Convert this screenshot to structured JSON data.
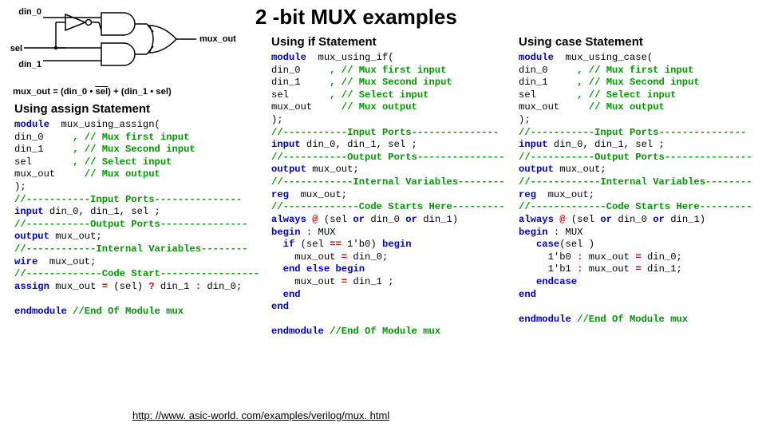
{
  "title": "2 -bit MUX examples",
  "headings": {
    "assign": "Using assign Statement",
    "if": "Using if Statement",
    "case": "Using case Statement"
  },
  "schematic": {
    "labels": {
      "din0": "din_0",
      "din1": "din_1",
      "sel": "sel",
      "out": "mux_out"
    },
    "equation_prefix": "mux_out = (din_0 • ",
    "equation_selbar": "sel",
    "equation_suffix": ") + (din_1 • sel)"
  },
  "code": {
    "assign": {
      "mod": "module",
      "name": "  mux_using_assign(",
      "p0": "din_0     ",
      "c0": ", // Mux first input",
      "p1": "din_1     ",
      "c1": ", // Mux Second input",
      "p2": "sel       ",
      "c2": ", // Select input",
      "p3": "mux_out   ",
      "c3": "  // Mux output",
      "close": ");",
      "sec_in": "//-----------Input Ports---------------",
      "inp": "input",
      "inpl": " din_0, din_1, sel ;",
      "sec_out": "//-----------Output Ports---------------",
      "outp": "output",
      "outpl": " mux_out;",
      "sec_var": "//------------Internal Variables--------",
      "wire": "wire",
      "wirel": "  mux_out;",
      "sec_code": "//-------------Code Start-----------------",
      "assign": "assign",
      "assignl1": " mux_out ",
      "assignl2": " (sel) ",
      "assignl3": " din_1 ",
      "assignl4": " din_0;",
      "endm": "endmodule",
      "endc": " //End Of Module mux"
    },
    "if": {
      "mod": "module",
      "name": "  mux_using_if(",
      "p0": "din_0     ",
      "c0": ", // Mux first input",
      "p1": "din_1     ",
      "c1": ", // Mux Second input",
      "p2": "sel       ",
      "c2": ", // Select input",
      "p3": "mux_out   ",
      "c3": "  // Mux output",
      "close": ");",
      "sec_in": "//-----------Input Ports---------------",
      "inp": "input",
      "inpl": " din_0, din_1, sel ;",
      "sec_out": "//-----------Output Ports---------------",
      "outp": "output",
      "outpl": " mux_out;",
      "sec_var": "//------------Internal Variables--------",
      "reg": "reg",
      "regl": "  mux_out;",
      "sec_code": "//-------------Code Starts Here---------",
      "always": "always",
      "at": " @ ",
      "sens1": "(sel ",
      "or": "or",
      "sens2": " din_0 ",
      "sens3": " din_1)",
      "begin": "begin",
      "beglab": " : MUX",
      "if": "  if",
      "ifcond1": " (sel ",
      "eqeq": "==",
      "ifcond2": " 1'b0) ",
      "begin2": "begin",
      "assign1a": "    mux_out ",
      "eq": "=",
      "assign1b": " din_0;",
      "endelse": "  end else begin",
      "assign2a": "    mux_out ",
      "assign2b": " din_1 ;",
      "end1": "  end",
      "end2": "end",
      "endm": "endmodule",
      "endc": " //End Of Module mux"
    },
    "case": {
      "mod": "module",
      "name": "  mux_using_case(",
      "p0": "din_0     ",
      "c0": ", // Mux first input",
      "p1": "din_1     ",
      "c1": ", // Mux Second input",
      "p2": "sel       ",
      "c2": ", // Select input",
      "p3": "mux_out   ",
      "c3": "  // Mux output",
      "close": ");",
      "sec_in": "//-----------Input Ports---------------",
      "inp": "input",
      "inpl": " din_0, din_1, sel ;",
      "sec_out": "//-----------Output Ports---------------",
      "outp": "output",
      "outpl": " mux_out;",
      "sec_var": "//------------Internal Variables--------",
      "reg": "reg",
      "regl": "  mux_out;",
      "sec_code": "//-------------Code Starts Here---------",
      "always": "always",
      "at": " @ ",
      "sens1": "(sel ",
      "or": "or",
      "sens2": " din_0 ",
      "sens3": " din_1)",
      "begin": "begin",
      "beglab": " : MUX",
      "case": "   case",
      "caseexpr": "(sel ) ",
      "l0a": "     1'b0 ",
      "colon": ":",
      "l0b": " mux_out ",
      "eq": "=",
      "l0c": " din_0;",
      "l1a": "     1'b1 ",
      "l1b": " mux_out ",
      "l1c": " din_1;",
      "endcase": "   endcase",
      "end": "end",
      "endm": "endmodule",
      "endc": " //End Of Module mux"
    }
  },
  "url": "http: //www. asic-world. com/examples/verilog/mux. html"
}
